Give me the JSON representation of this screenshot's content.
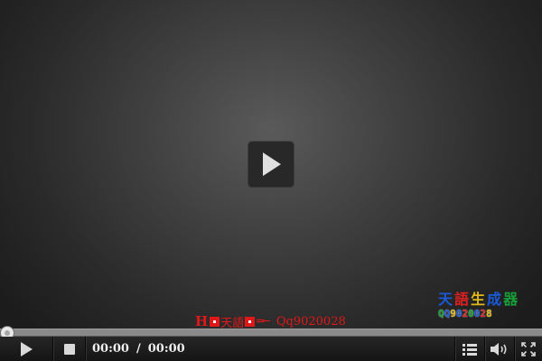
{
  "player": {
    "watermark": {
      "brand": "天語",
      "dashes": "═─",
      "qq": "Qq9020028"
    },
    "logo": {
      "chars": [
        {
          "text": "天",
          "color": "#1a5ad8"
        },
        {
          "text": "語",
          "color": "#e02020"
        },
        {
          "text": "生",
          "color": "#e0b818"
        },
        {
          "text": "成",
          "color": "#1a5ad8"
        },
        {
          "text": "器",
          "color": "#18a038"
        }
      ],
      "digits": [
        {
          "text": "Q",
          "color": "#18a038"
        },
        {
          "text": "Q",
          "color": "#1a5ad8"
        },
        {
          "text": "9",
          "color": "#e0b818"
        },
        {
          "text": "0",
          "color": "#1a5ad8"
        },
        {
          "text": "2",
          "color": "#e02020"
        },
        {
          "text": "0",
          "color": "#18a038"
        },
        {
          "text": "0",
          "color": "#1a5ad8"
        },
        {
          "text": "2",
          "color": "#e02020"
        },
        {
          "text": "8",
          "color": "#e0b818"
        }
      ]
    },
    "progress": 0,
    "time": {
      "current": "00:00",
      "separator": "/",
      "total": "00:00"
    },
    "icons": {
      "big_play": "play-icon",
      "play": "play-icon",
      "stop": "stop-icon",
      "playlist": "list-icon",
      "volume": "volume-icon",
      "fullscreen": "fullscreen-icon"
    },
    "colors": {
      "watermark": "#e01818",
      "control_icon": "#d9d9d9",
      "background": "#1b1b1b"
    }
  }
}
